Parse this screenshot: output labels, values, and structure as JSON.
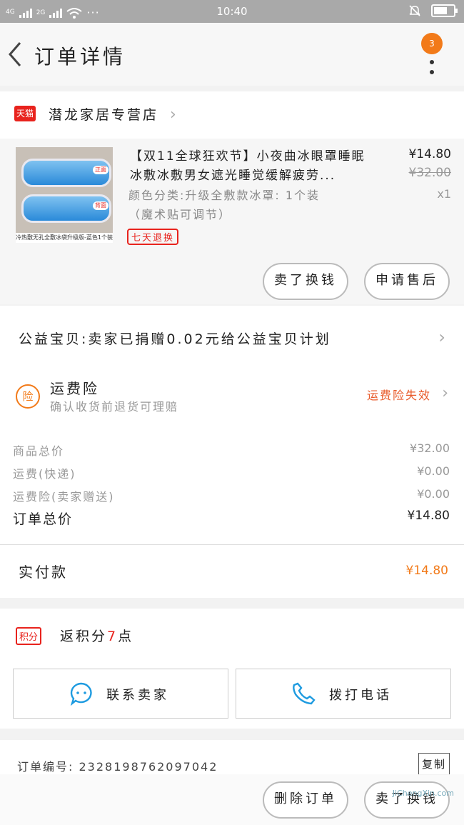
{
  "status_bar": {
    "net_left": "4G",
    "net_right": "2G",
    "dots": "···",
    "time": "10:40"
  },
  "header": {
    "title": "订单详情",
    "badge": "3"
  },
  "shop": {
    "logo_text": "天猫",
    "name": "潜龙家居专营店"
  },
  "product": {
    "title": "【双11全球狂欢节】小夜曲冰眼罩睡眠冰敷冰敷男女遮光睡觉缓解疲劳...",
    "spec": "颜色分类:升级全敷款冰罩: 1个装（魔术贴可调节）",
    "return_badge": "七天退换",
    "price": "¥14.80",
    "original_price": "¥32.00",
    "qty": "x1",
    "image_caption": "冷热敷无孔全敷冰袋升级版-蓝色1个装",
    "image_tag_front": "正面",
    "image_tag_back": "背面",
    "btn_buy_more": "卖了换钱",
    "btn_after_sale": "申请售后"
  },
  "charity": {
    "text": "公益宝贝:卖家已捐赠0.02元给公益宝贝计划"
  },
  "freight": {
    "icon_text": "险",
    "title": "运费险",
    "desc": "确认收货前退货可理赔",
    "status": "运费险失效"
  },
  "fees": [
    {
      "label": "商品总价",
      "value": "¥32.00"
    },
    {
      "label": "运费(快递)",
      "value": "¥0.00"
    },
    {
      "label": "运费险(卖家赠送)",
      "value": "¥0.00"
    }
  ],
  "total": {
    "label": "订单总价",
    "value": "¥14.80"
  },
  "paid": {
    "label": "实付款",
    "value": "¥14.80"
  },
  "points": {
    "tag": "积分",
    "text_prefix": "返积分",
    "count": "7",
    "text_suffix": "点"
  },
  "contact": {
    "seller": "联系卖家",
    "phone": "拨打电话"
  },
  "order": {
    "label": "订单编号:",
    "number": "2328198762097042",
    "copy": "复制"
  },
  "bottom": {
    "delete": "删除订单",
    "sell": "卖了换钱"
  },
  "watermark": "JiChengXin.com",
  "colors": {
    "accent": "#f27a19",
    "tmall_red": "#e8231d"
  }
}
